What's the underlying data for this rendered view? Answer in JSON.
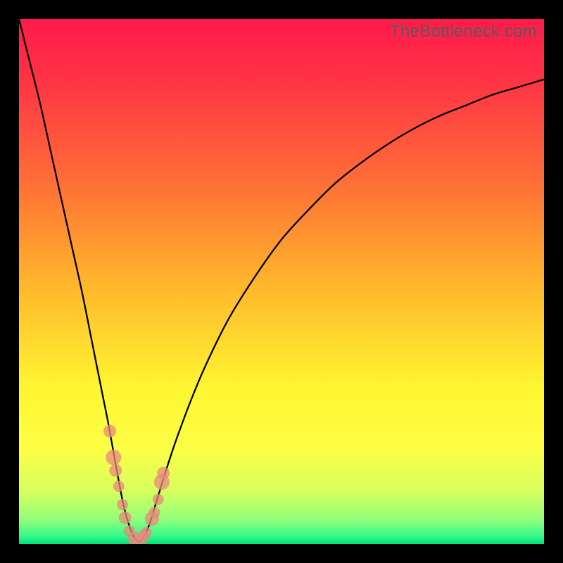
{
  "watermark": "TheBottleneck.com",
  "colors": {
    "frame": "#000000",
    "curve": "#000000",
    "marker": "#e8887e",
    "gradient_stops": [
      {
        "offset": 0.0,
        "color": "#ff1a4b"
      },
      {
        "offset": 0.12,
        "color": "#ff3445"
      },
      {
        "offset": 0.3,
        "color": "#ff6b37"
      },
      {
        "offset": 0.5,
        "color": "#ffb42c"
      },
      {
        "offset": 0.7,
        "color": "#fff531"
      },
      {
        "offset": 0.82,
        "color": "#fdff45"
      },
      {
        "offset": 0.9,
        "color": "#d6ff5e"
      },
      {
        "offset": 0.955,
        "color": "#8fff7a"
      },
      {
        "offset": 0.985,
        "color": "#35f989"
      },
      {
        "offset": 1.0,
        "color": "#00e27a"
      }
    ]
  },
  "chart_data": {
    "type": "line",
    "title": "",
    "xlabel": "",
    "ylabel": "",
    "xlim": [
      0,
      100
    ],
    "ylim": [
      0,
      100
    ],
    "x": [
      0,
      2,
      4,
      6,
      8,
      10,
      12,
      14,
      16,
      17,
      18,
      19,
      20,
      21,
      22,
      23,
      24,
      25,
      26,
      28,
      30,
      33,
      36,
      40,
      45,
      50,
      55,
      60,
      65,
      70,
      75,
      80,
      85,
      90,
      95,
      100
    ],
    "values": [
      100,
      92,
      84,
      75,
      66,
      57,
      48,
      38,
      28,
      23,
      17.5,
      12,
      7,
      3.5,
      1.2,
      0.5,
      1.8,
      4.2,
      7.5,
      14,
      20,
      28,
      35,
      43,
      51,
      58,
      63.5,
      68.5,
      72.5,
      76,
      79,
      81.5,
      83.5,
      85.5,
      87,
      88.5
    ],
    "markers": {
      "x": [
        17.3,
        18.0,
        18.4,
        19.0,
        20.2,
        21.0,
        22.0,
        23.0,
        24.2,
        25.3,
        25.8,
        26.5,
        27.2,
        27.5,
        19.7,
        23.8
      ],
      "y": [
        21.5,
        16.5,
        14.0,
        11.0,
        5.0,
        2.5,
        1.0,
        0.6,
        2.2,
        4.8,
        6.0,
        8.5,
        11.8,
        13.5,
        7.5,
        1.6
      ],
      "r": [
        9,
        11,
        9,
        8,
        9,
        8,
        10,
        10,
        8,
        10,
        8,
        8,
        11,
        9,
        8,
        8
      ]
    }
  }
}
